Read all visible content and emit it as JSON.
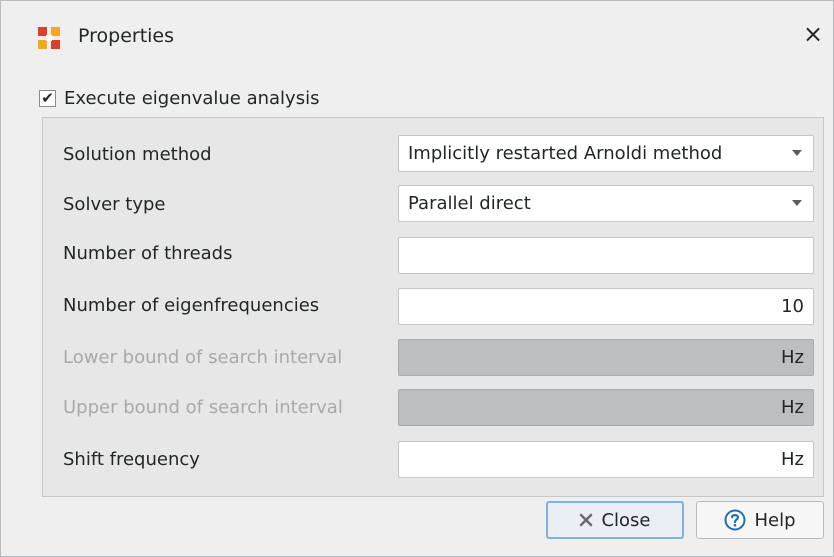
{
  "window": {
    "title": "Properties",
    "app_icon": "app-logo-icon",
    "close_glyph": "×"
  },
  "execute": {
    "checked": true,
    "label": "Execute eigenvalue analysis"
  },
  "fields": {
    "solution_method": {
      "label": "Solution method",
      "value": "Implicitly restarted Arnoldi method",
      "type": "dropdown"
    },
    "solver_type": {
      "label": "Solver type",
      "value": "Parallel direct",
      "type": "dropdown"
    },
    "threads": {
      "label": "Number of threads",
      "value": ""
    },
    "eigenfrequencies": {
      "label": "Number of eigenfrequencies",
      "value": "10"
    },
    "lower_bound": {
      "label": "Lower bound of search interval",
      "value": "Hz",
      "disabled": true
    },
    "upper_bound": {
      "label": "Upper bound of search interval",
      "value": "Hz",
      "disabled": true
    },
    "shift": {
      "label": "Shift frequency",
      "value": "Hz"
    }
  },
  "buttons": {
    "close_label": "Close",
    "help_label": "Help",
    "close_icon": "close-x-icon",
    "help_icon": "help-icon"
  },
  "colors": {
    "accent": "#1f6fb5",
    "disabled_field": "#bdbebf",
    "disabled_text": "#a7a9ab"
  }
}
